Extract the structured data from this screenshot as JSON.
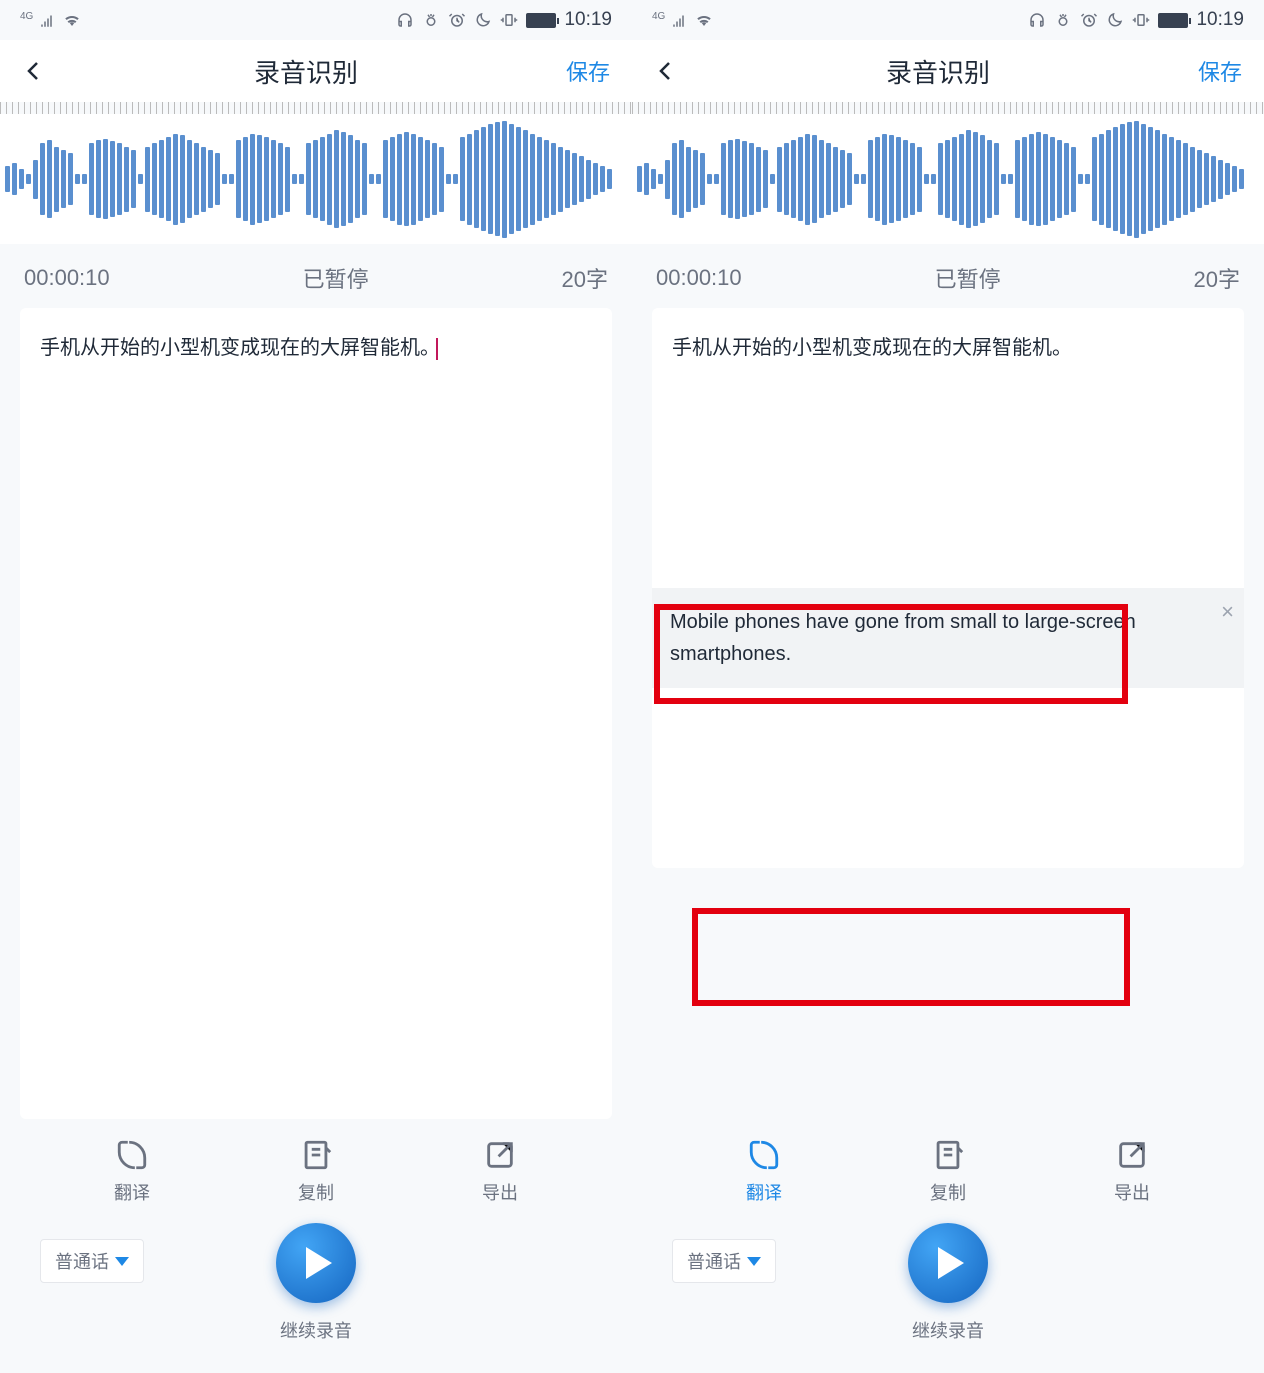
{
  "status": {
    "signal": "4G",
    "time": "10:19"
  },
  "header": {
    "title": "录音识别",
    "save": "保存"
  },
  "playback": {
    "time": "00:00:10",
    "state": "已暂停",
    "count": "20字"
  },
  "transcript": "手机从开始的小型机变成现在的大屏智能机。",
  "translation": "Mobile phones have gone from small to large-screen smartphones.",
  "actions": {
    "translate": "翻译",
    "copy": "复制",
    "export": "导出"
  },
  "footer": {
    "language": "普通话",
    "record": "继续录音"
  },
  "waveform_heights": [
    20,
    25,
    15,
    8,
    30,
    55,
    60,
    50,
    45,
    40,
    8,
    8,
    55,
    60,
    62,
    58,
    55,
    50,
    45,
    8,
    50,
    55,
    60,
    65,
    70,
    68,
    60,
    55,
    50,
    45,
    40,
    8,
    8,
    60,
    65,
    70,
    68,
    65,
    60,
    55,
    50,
    8,
    8,
    55,
    60,
    65,
    70,
    75,
    72,
    68,
    60,
    55,
    8,
    8,
    60,
    65,
    70,
    72,
    70,
    65,
    60,
    55,
    50,
    8,
    8,
    65,
    70,
    75,
    80,
    85,
    88,
    90,
    85,
    80,
    75,
    70,
    65,
    60,
    55,
    50,
    45,
    40,
    35,
    30,
    25,
    20,
    15
  ]
}
